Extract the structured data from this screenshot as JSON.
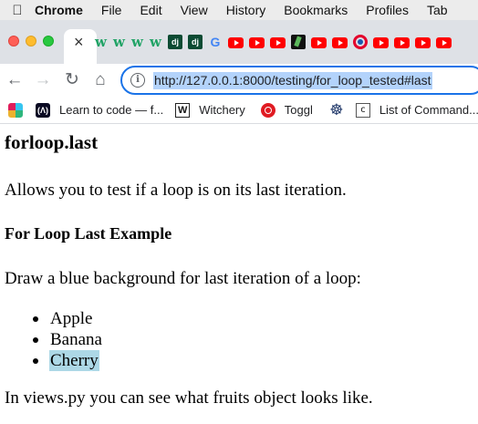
{
  "menubar": {
    "apple_icon": "apple-icon",
    "app_name": "Chrome",
    "items": [
      "File",
      "Edit",
      "View",
      "History",
      "Bookmarks",
      "Profiles",
      "Tab"
    ]
  },
  "tabs": {
    "active_close_glyph": "×",
    "favicons": [
      "w",
      "w",
      "w",
      "w",
      "dj",
      "dj",
      "G",
      "youtube",
      "youtube",
      "youtube",
      "scientist",
      "youtube",
      "youtube",
      "ring",
      "youtube",
      "youtube",
      "youtube",
      "youtube"
    ]
  },
  "toolbar": {
    "url": "http://127.0.0.1:8000/testing/for_loop_tested#last"
  },
  "bookmarks": {
    "items": [
      {
        "label": "",
        "icon": "slack-icon"
      },
      {
        "label": "Learn to code — f...",
        "icon": "freecodecamp-icon"
      },
      {
        "label": "Witchery",
        "icon": "witchery-icon"
      },
      {
        "label": "Toggl",
        "icon": "toggl-icon"
      },
      {
        "label": "",
        "icon": "helm-icon"
      },
      {
        "label": "List of Command...",
        "icon": "document-icon"
      }
    ]
  },
  "page": {
    "title": "forloop.last",
    "intro": "Allows you to test if a loop is on its last iteration.",
    "example_heading": "For Loop Last Example",
    "example_description": "Draw a blue background for last iteration of a loop:",
    "fruits": [
      "Apple",
      "Banana",
      "Cherry"
    ],
    "highlight_color": "#add8e6",
    "footer_text": "In views.py you can see what fruits object looks like."
  },
  "colors": {
    "omnibox_focus": "#1a73e8",
    "url_selection": "#b3d3fb"
  }
}
